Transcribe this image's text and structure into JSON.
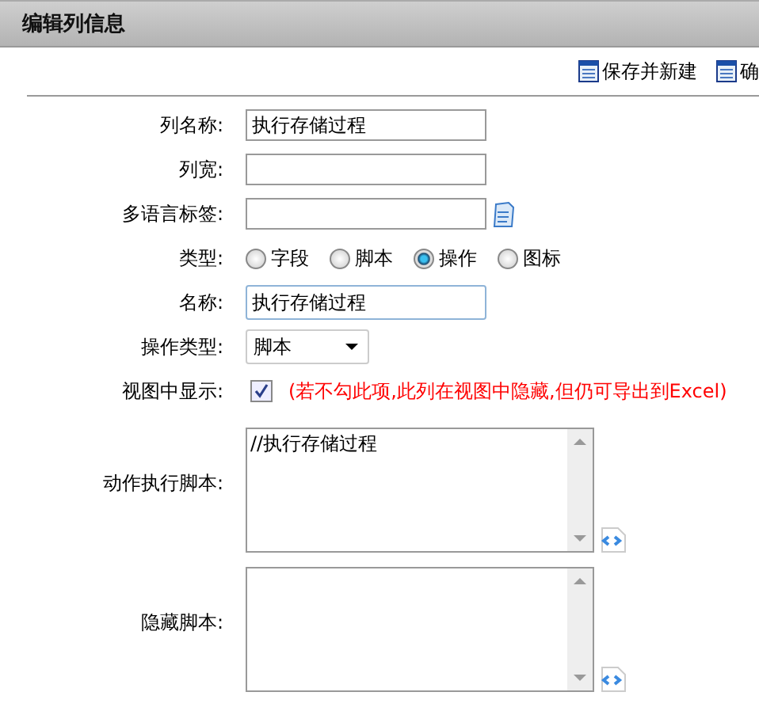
{
  "header": {
    "title": "编辑列信息"
  },
  "toolbar": [
    {
      "label": "保存并新建"
    },
    {
      "label": "确"
    }
  ],
  "fields": [
    {
      "kind": "text",
      "label": "列名称:",
      "value": "执行存储过程",
      "focused": false
    },
    {
      "kind": "text",
      "label": "列宽:",
      "focused": false
    },
    {
      "kind": "text-icon",
      "label": "多语言标签:",
      "focused": false
    },
    {
      "kind": "radio",
      "label": "类型:",
      "options": [
        {
          "label": "字段",
          "selected": false
        },
        {
          "label": "脚本",
          "selected": false
        },
        {
          "label": "操作",
          "selected": true
        },
        {
          "label": "图标",
          "selected": false
        }
      ]
    },
    {
      "kind": "text",
      "label": "名称:",
      "value": "执行存储过程",
      "focused": true
    },
    {
      "kind": "select",
      "label": "操作类型:",
      "value": "脚本"
    },
    {
      "kind": "checkbox",
      "label": "视图中显示:",
      "checked": true,
      "note": "(若不勾此项,此列在视图中隐藏,但仍可导出到Excel)"
    },
    {
      "kind": "textarea",
      "label": "动作执行脚本:",
      "value": "//执行存储过程"
    },
    {
      "kind": "textarea",
      "label": "隐藏脚本:"
    }
  ]
}
